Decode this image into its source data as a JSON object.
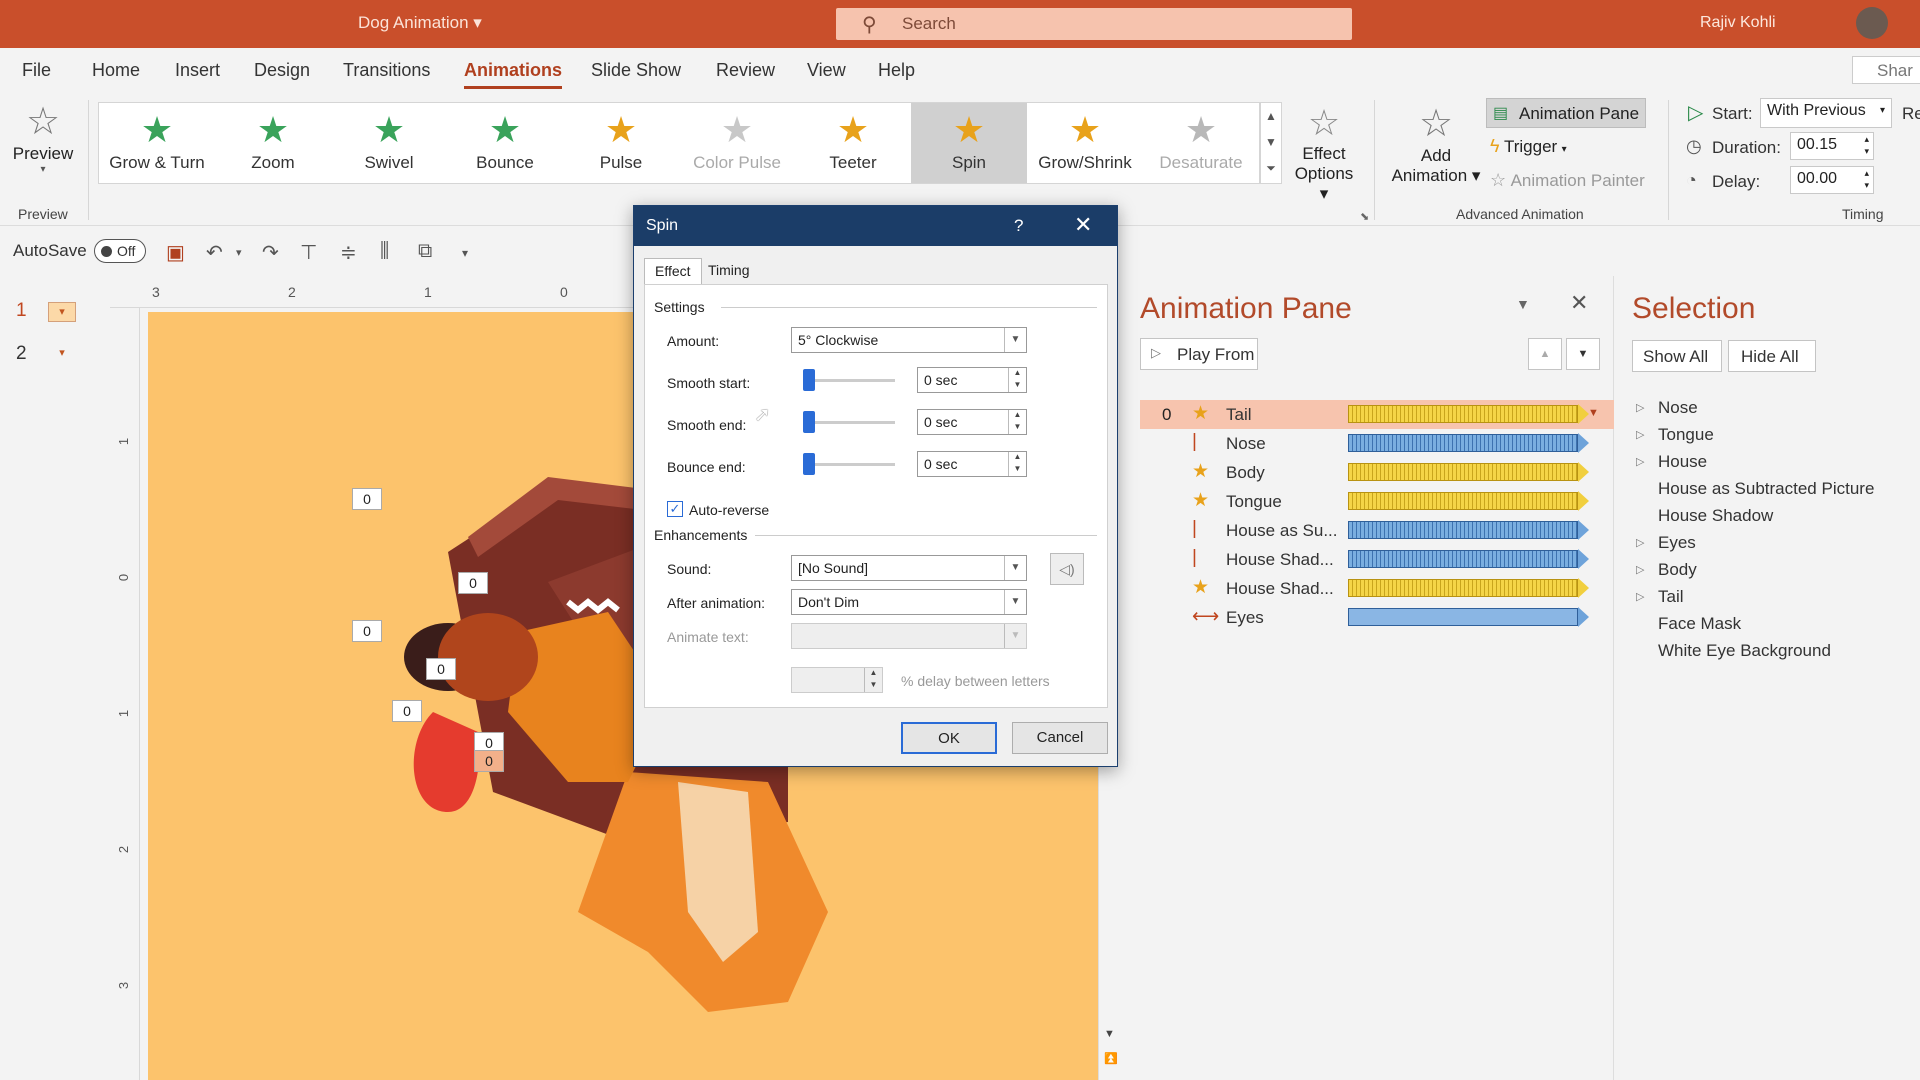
{
  "titlebar": {
    "doc_title": "Dog Animation",
    "search_placeholder": "Search",
    "user_name": "Rajiv Kohli"
  },
  "menu": {
    "items": [
      "File",
      "Home",
      "Insert",
      "Design",
      "Transitions",
      "Animations",
      "Slide Show",
      "Review",
      "View",
      "Help"
    ],
    "share": "Shar"
  },
  "ribbon": {
    "preview_label": "Preview",
    "preview_group": "Preview",
    "effects": [
      {
        "label": "Grow & Turn",
        "color": "#3aa35b"
      },
      {
        "label": "Zoom",
        "color": "#3aa35b"
      },
      {
        "label": "Swivel",
        "color": "#3aa35b"
      },
      {
        "label": "Bounce",
        "color": "#3aa35b"
      },
      {
        "label": "Pulse",
        "color": "#e8a21b"
      },
      {
        "label": "Color Pulse",
        "color": "#c8c8c8"
      },
      {
        "label": "Teeter",
        "color": "#e8a21b"
      },
      {
        "label": "Spin",
        "color": "#e8a21b"
      },
      {
        "label": "Grow/Shrink",
        "color": "#e8a21b"
      },
      {
        "label": "Desaturate",
        "color": "#b8b8b8"
      }
    ],
    "effect_options_1": "Effect",
    "effect_options_2": "Options",
    "add_animation_1": "Add",
    "add_animation_2": "Animation",
    "animation_pane": "Animation Pane",
    "trigger": "Trigger",
    "animation_painter": "Animation Painter",
    "advanced_group": "Advanced Animation",
    "start_label": "Start:",
    "start_value": "With Previous",
    "duration_label": "Duration:",
    "duration_value": "00.15",
    "delay_label": "Delay:",
    "delay_value": "00.00",
    "timing_group": "Timing",
    "reorder_cut": "Re"
  },
  "qat": {
    "autosave": "AutoSave",
    "toggle": "Off"
  },
  "slides": [
    "1",
    "2"
  ],
  "ruler": {
    "h": [
      "3",
      "2",
      "1",
      "0"
    ],
    "v": [
      "1",
      "0",
      "1",
      "2",
      "3"
    ]
  },
  "slide_tags": [
    "0",
    "0",
    "0",
    "0",
    "0",
    "0",
    "0"
  ],
  "dialog": {
    "title": "Spin",
    "help": "?",
    "tab_effect": "Effect",
    "tab_timing": "Timing",
    "settings": "Settings",
    "amount_label": "Amount:",
    "amount_value": "5° Clockwise",
    "smooth_start_label": "Smooth start:",
    "smooth_start_value": "0 sec",
    "smooth_end_label": "Smooth end:",
    "smooth_end_value": "0 sec",
    "bounce_end_label": "Bounce end:",
    "bounce_end_value": "0 sec",
    "auto_reverse": "Auto-reverse",
    "enhancements": "Enhancements",
    "sound_label": "Sound:",
    "sound_value": "[No Sound]",
    "after_label": "After animation:",
    "after_value": "Don't Dim",
    "animate_text_label": "Animate text:",
    "delay_letters": "% delay between letters",
    "ok": "OK",
    "cancel": "Cancel"
  },
  "anim_pane": {
    "title": "Animation Pane",
    "play_from": "Play From",
    "rows": [
      {
        "num": "0",
        "name": "Tail",
        "kind": "gold",
        "icon": "star"
      },
      {
        "num": "",
        "name": "Nose",
        "kind": "blue",
        "icon": "line"
      },
      {
        "num": "",
        "name": "Body",
        "kind": "gold",
        "icon": "star"
      },
      {
        "num": "",
        "name": "Tongue",
        "kind": "gold",
        "icon": "star"
      },
      {
        "num": "",
        "name": "House as Su...",
        "kind": "blue",
        "icon": "line"
      },
      {
        "num": "",
        "name": "House Shad...",
        "kind": "blue",
        "icon": "line"
      },
      {
        "num": "",
        "name": "House Shad...",
        "kind": "gold",
        "icon": "star"
      },
      {
        "num": "",
        "name": "Eyes",
        "kind": "plain",
        "icon": "path"
      }
    ]
  },
  "selection": {
    "title": "Selection",
    "show_all": "Show All",
    "hide_all": "Hide All",
    "items": [
      {
        "name": "Nose",
        "group": true
      },
      {
        "name": "Tongue",
        "group": true
      },
      {
        "name": "House",
        "group": true
      },
      {
        "name": "House as Subtracted Picture",
        "group": false
      },
      {
        "name": "House Shadow",
        "group": false
      },
      {
        "name": "Eyes",
        "group": true
      },
      {
        "name": "Body",
        "group": true
      },
      {
        "name": "Tail",
        "group": true
      },
      {
        "name": "Face Mask",
        "group": false
      },
      {
        "name": "White Eye Background",
        "group": false
      }
    ]
  }
}
